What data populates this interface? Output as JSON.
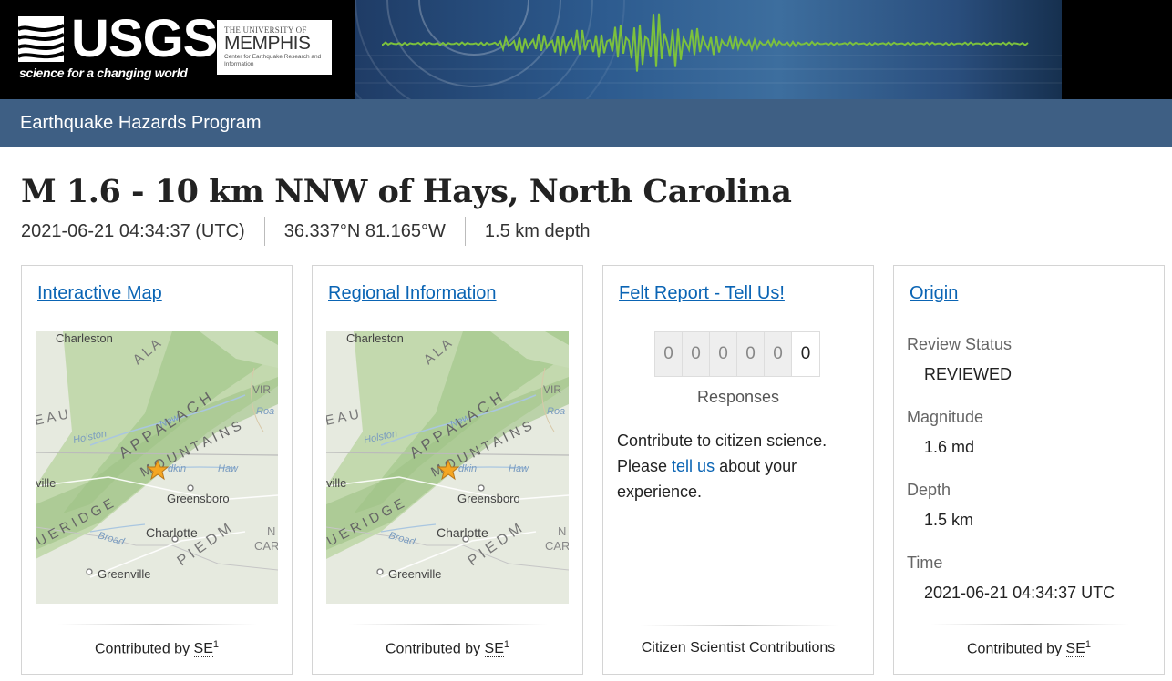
{
  "header": {
    "usgs_wordmark": "USGS",
    "usgs_tagline": "science for a changing world",
    "memphis_top": "THE UNIVERSITY OF",
    "memphis_name": "MEMPHIS",
    "memphis_sub": "Center for Earthquake Research and Information",
    "program_title": "Earthquake Hazards Program"
  },
  "event": {
    "title": "M 1.6 - 10 km NNW of Hays, North Carolina",
    "time": "2021-06-21 04:34:37 (UTC)",
    "location": "36.337°N 81.165°W",
    "depth": "1.5 km depth"
  },
  "cards": {
    "interactive_map": {
      "title": "Interactive Map",
      "footer_prefix": "Contributed by ",
      "footer_abbr": "SE",
      "footer_sup": "1"
    },
    "regional_information": {
      "title": "Regional Information",
      "footer_prefix": "Contributed by ",
      "footer_abbr": "SE",
      "footer_sup": "1"
    },
    "felt_report": {
      "title": "Felt Report - Tell Us!",
      "digits": [
        "0",
        "0",
        "0",
        "0",
        "0",
        "0"
      ],
      "responses_label": "Responses",
      "text_line1": "Contribute to citizen science.",
      "text_please": "Please ",
      "link": "tell us",
      "text_rest": " about your experience.",
      "footer": "Citizen Scientist Contributions"
    },
    "origin": {
      "title": "Origin",
      "review_status_label": "Review Status",
      "review_status_value": "REVIEWED",
      "magnitude_label": "Magnitude",
      "magnitude_value": "1.6 md",
      "depth_label": "Depth",
      "depth_value": "1.5 km",
      "time_label": "Time",
      "time_value": "2021-06-21 04:34:37 UTC",
      "footer_prefix": "Contributed by ",
      "footer_abbr": "SE",
      "footer_sup": "1"
    }
  },
  "map_labels": {
    "charleston": "Charleston",
    "greensboro": "Greensboro",
    "charlotte": "Charlotte",
    "greenville": "Greenville",
    "ville": "ville",
    "vir": "VIR",
    "roa": "Roa",
    "holston": "Holston",
    "new": "New",
    "haw": "Haw",
    "yadkin": "dkin",
    "broad": "Broad",
    "eau": "E A U",
    "appalach": "A P P A L A C H",
    "ala": "A L A",
    "mountains": "M O U N T A I N S",
    "blue_ridge": "U E   R I D G E",
    "piedm": "P I E D M",
    "no": "N",
    "car": "CAR"
  },
  "colors": {
    "nav": "#3e5f84",
    "link": "#0a64b4",
    "map_land": "#e6eadf",
    "map_green": "#b9d4a4",
    "star": "#f5a623"
  }
}
